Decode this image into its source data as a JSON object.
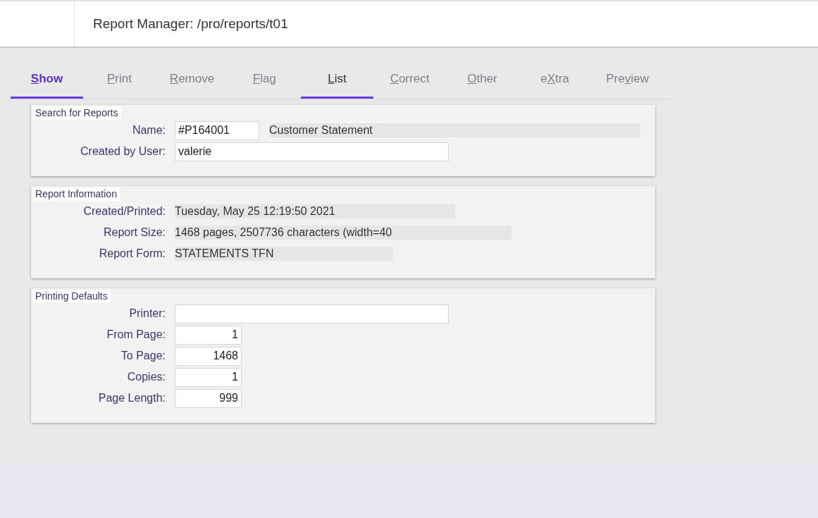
{
  "header": {
    "title": "Report Manager: /pro/reports/t01"
  },
  "tabs": [
    {
      "key": "S",
      "after": "how",
      "selected": true,
      "hovered": false
    },
    {
      "key": "P",
      "after": "rint",
      "selected": false,
      "hovered": false
    },
    {
      "key": "R",
      "after": "emove",
      "selected": false,
      "hovered": false
    },
    {
      "key": "F",
      "after": "lag",
      "selected": false,
      "hovered": false
    },
    {
      "key": "L",
      "after": "ist",
      "selected": false,
      "hovered": true
    },
    {
      "key": "C",
      "after": "orrect",
      "selected": false,
      "hovered": false
    },
    {
      "key": "O",
      "after": "ther",
      "selected": false,
      "hovered": false
    },
    {
      "before": "e",
      "key": "X",
      "after": "tra",
      "selected": false,
      "hovered": false
    },
    {
      "before": "Pre",
      "key": "v",
      "after": "iew",
      "selected": false,
      "hovered": false
    }
  ],
  "sections": [
    {
      "title": "Search for Reports",
      "rows": [
        {
          "label": "Name:",
          "fields": [
            {
              "kind": "code-input",
              "value": "#P164001"
            },
            {
              "kind": "readout-fill",
              "value": "Customer Statement"
            }
          ]
        },
        {
          "label": "Created by User:",
          "fields": [
            {
              "kind": "text-input",
              "value": "valerie"
            }
          ]
        }
      ]
    },
    {
      "title": "Report Information",
      "rows": [
        {
          "label": "Created/Printed:",
          "fields": [
            {
              "kind": "readout",
              "value": "Tuesday, May 25 12:19:50 2021"
            }
          ]
        },
        {
          "label": "Report Size:",
          "fields": [
            {
              "kind": "readout",
              "value": "1468 pages, 2507736 characters (width=40"
            }
          ]
        },
        {
          "label": "Report Form:",
          "fields": [
            {
              "kind": "readout",
              "value": "STATEMENTS TFN"
            }
          ]
        }
      ]
    },
    {
      "title": "Printing Defaults",
      "rows": [
        {
          "label": "Printer:",
          "fields": [
            {
              "kind": "text-input"
            }
          ]
        },
        {
          "label": "From Page:",
          "fields": [
            {
              "kind": "number-input",
              "value": "1"
            }
          ]
        },
        {
          "label": "To Page:",
          "fields": [
            {
              "kind": "number-input",
              "value": "1468"
            }
          ]
        },
        {
          "label": "Copies:",
          "fields": [
            {
              "kind": "number-input",
              "value": "1"
            }
          ]
        },
        {
          "label": "Page Length:",
          "fields": [
            {
              "kind": "number-input",
              "value": "999"
            }
          ]
        }
      ]
    }
  ]
}
